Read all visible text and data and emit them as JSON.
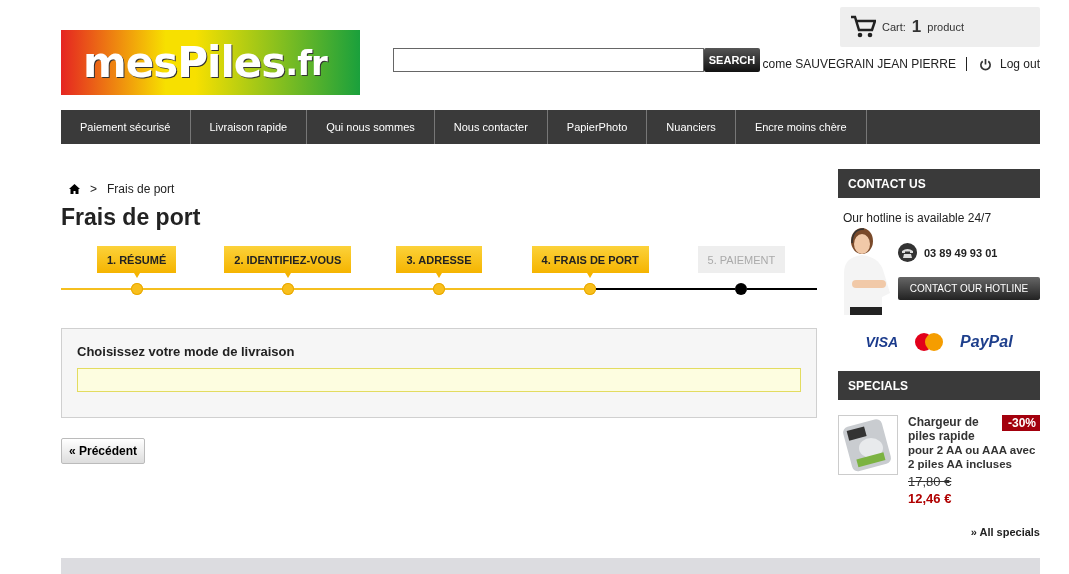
{
  "logo": {
    "name": "mesPiles",
    "tld": ".fr"
  },
  "search": {
    "button": "SEARCH"
  },
  "cart": {
    "label": "Cart:",
    "count": "1",
    "unit": "product"
  },
  "user": {
    "welcome": "come SAUVEGRAIN JEAN PIERRE",
    "logout": "Log out"
  },
  "nav": [
    "Paiement sécurisé",
    "Livraison rapide",
    "Qui nous sommes",
    "Nous contacter",
    "PapierPhoto",
    "Nuanciers",
    "Encre moins chère"
  ],
  "breadcrumb": {
    "separator": ">",
    "current": "Frais de port"
  },
  "title": "Frais de port",
  "steps": [
    {
      "label": "1. RÉSUMÉ",
      "done": true
    },
    {
      "label": "2. IDENTIFIEZ-VOUS",
      "done": true
    },
    {
      "label": "3. ADRESSE",
      "done": true
    },
    {
      "label": "4. FRAIS DE PORT",
      "done": true
    },
    {
      "label": "5. PAIEMENT",
      "done": false
    }
  ],
  "delivery": {
    "heading": "Choisissez votre mode de livraison"
  },
  "back_button": "« Précédent",
  "contact": {
    "header": "CONTACT US",
    "hotline": "Our hotline is available 24/7",
    "phone": "03 89 49 93 01",
    "button": "CONTACT OUR HOTLINE",
    "payments": [
      "VISA",
      "PayPal"
    ]
  },
  "specials": {
    "header": "SPECIALS",
    "product": {
      "kind": "picture",
      "name": "Chargeur de piles rapide",
      "name_rest": "pour 2 AA ou AAA avec 2 piles AA incluses",
      "discount": "-30%",
      "old_price": "17,80 €",
      "price": "12,46 €"
    },
    "link": "» All specials"
  }
}
